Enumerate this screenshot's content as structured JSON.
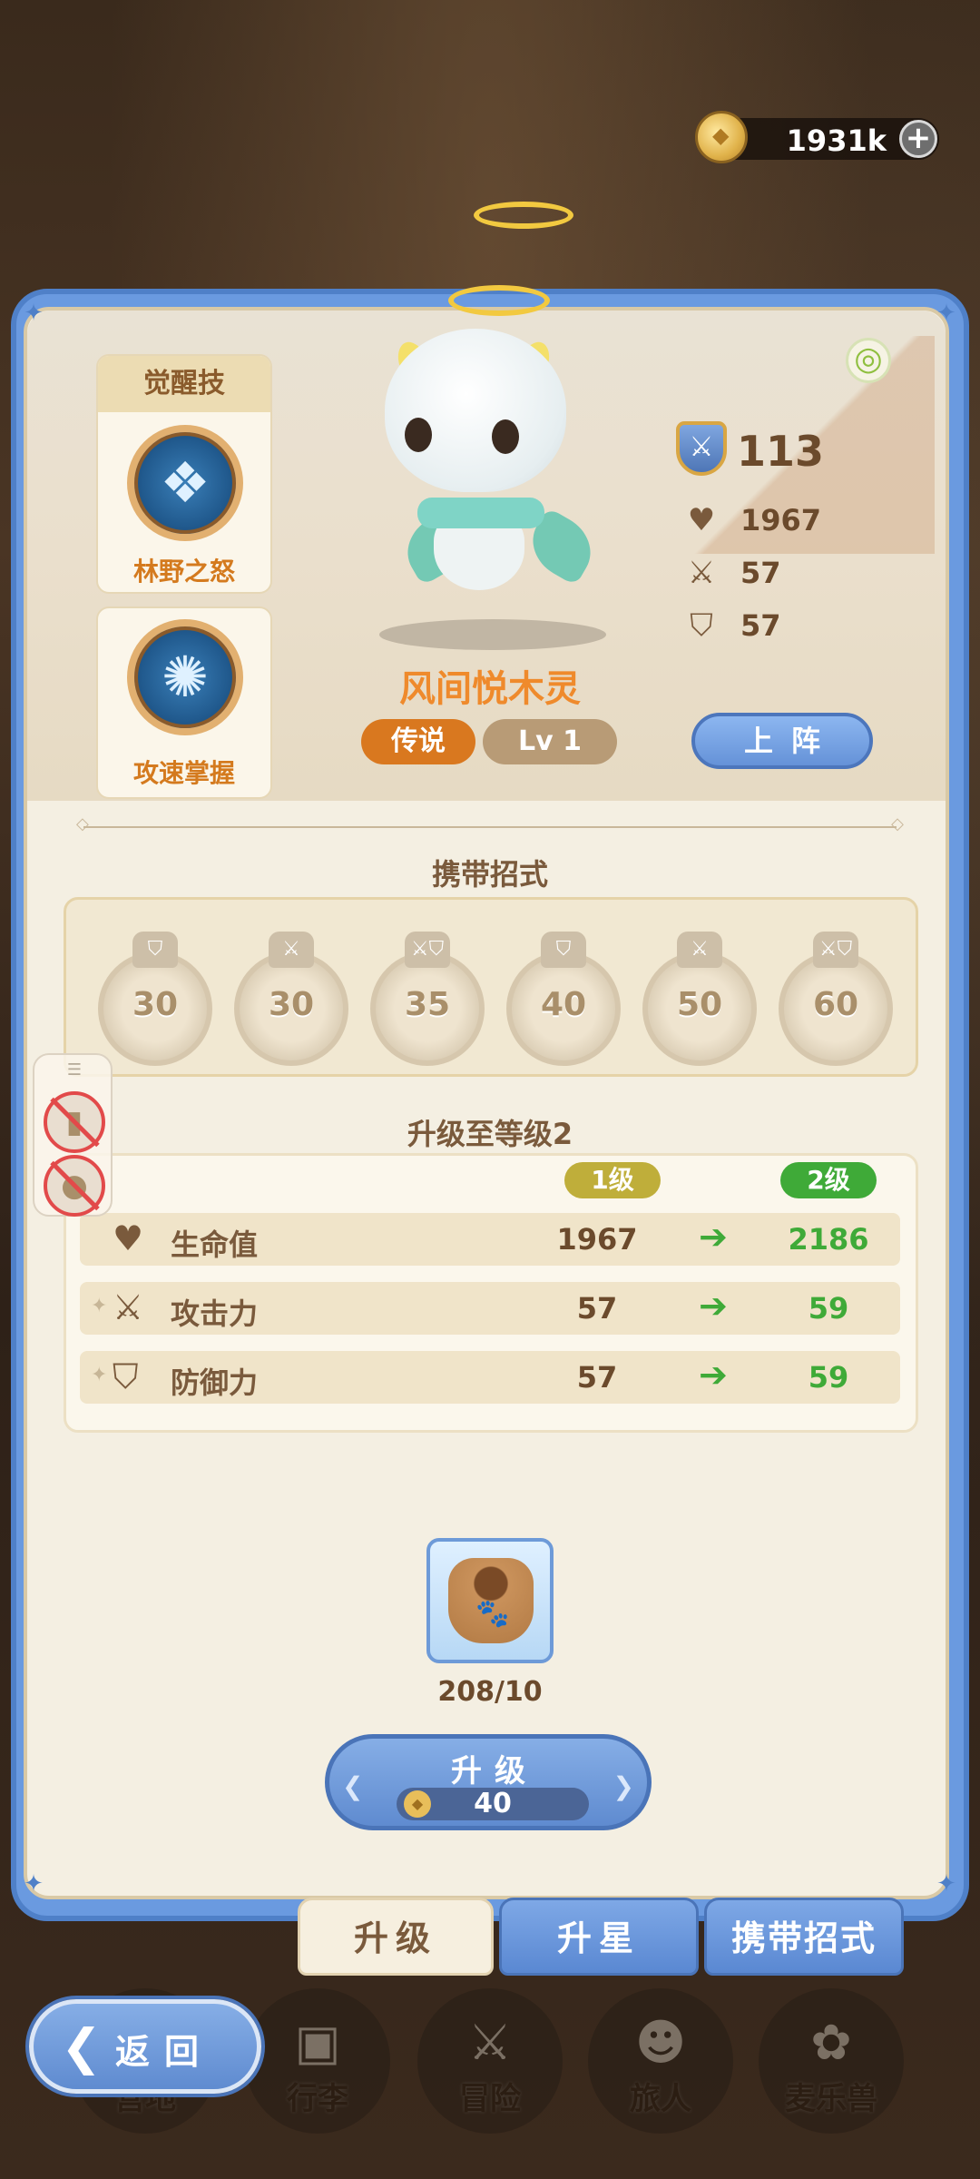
{
  "currency": {
    "amount": "1931k",
    "icon": "gold-coin-icon",
    "add_icon": "plus-icon"
  },
  "skills": {
    "header": "觉醒技",
    "items": [
      {
        "name": "林野之怒",
        "icon": "owl-spirit-icon"
      },
      {
        "name": "攻速掌握",
        "icon": "wolf-spirit-icon"
      }
    ]
  },
  "pet": {
    "name": "风间悦木灵",
    "rarity": "传说",
    "level": "Lv 1",
    "power": "113",
    "hp": "1967",
    "attack": "57",
    "defense": "57",
    "deploy_label": "上阵",
    "element_icon": "wind-swirl-icon"
  },
  "moves": {
    "title": "携带招式",
    "items": [
      {
        "level": "30",
        "icon": "shield-icon"
      },
      {
        "level": "30",
        "icon": "swords-icon"
      },
      {
        "level": "35",
        "icon": "swords-shield-icon"
      },
      {
        "level": "40",
        "icon": "shield-icon"
      },
      {
        "level": "50",
        "icon": "swords-icon"
      },
      {
        "level": "60",
        "icon": "swords-shield-icon"
      }
    ]
  },
  "upgrade": {
    "title": "升级至等级2",
    "from_label": "1级",
    "to_label": "2级",
    "rows": [
      {
        "label": "生命值",
        "from": "1967",
        "to": "2186",
        "icon": "heart-icon"
      },
      {
        "label": "攻击力",
        "from": "57",
        "to": "59",
        "icon": "swords-icon"
      },
      {
        "label": "防御力",
        "from": "57",
        "to": "59",
        "icon": "shield-icon"
      }
    ],
    "item_count": "208/10",
    "button_label": "升级",
    "cost": "40"
  },
  "tabs": [
    {
      "label": "升级",
      "active": true
    },
    {
      "label": "升星",
      "active": false
    },
    {
      "label": "携带招式",
      "active": false
    }
  ],
  "nav": {
    "back_label": "返回",
    "items": [
      {
        "label": "营地"
      },
      {
        "label": "行李"
      },
      {
        "label": "冒险"
      },
      {
        "label": "旅人"
      },
      {
        "label": "麦乐兽"
      }
    ]
  },
  "colors": {
    "panel_blue": "#6a9ae0",
    "panel_cream": "#f4efe2",
    "accent_orange": "#ef8a2c",
    "green": "#3faa38",
    "legend_badge": "#d9781f"
  }
}
